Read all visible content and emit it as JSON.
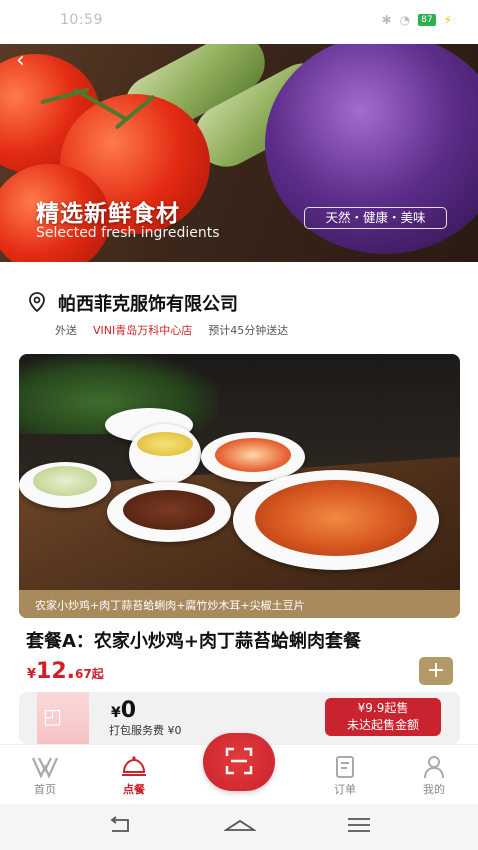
{
  "status_bar": {
    "time": "10:59",
    "battery": "87"
  },
  "hero": {
    "title": "精选新鲜食材",
    "subtitle": "Selected fresh ingredients",
    "tag": "天然・健康・美味"
  },
  "store": {
    "name": "帕西菲克服饰有限公司",
    "delivery_type": "外送",
    "branch": "VINI青岛万科中心店",
    "eta": "预计45分钟送达"
  },
  "product": {
    "caption": "农家小炒鸡+肉丁蒜苔蛤蜊肉+腐竹炒木耳+尖椒土豆片",
    "title": "套餐A：农家小炒鸡+肉丁蒜苔蛤蜊肉套餐",
    "price_currency": "¥",
    "price_main": "12.",
    "price_decimal": "67起",
    "add_label": "+"
  },
  "cart": {
    "currency": "¥",
    "total": "0",
    "pack_fee": "打包服务费 ¥0",
    "min_line1": "¥9.9起售",
    "min_line2": "未达起售金额"
  },
  "tabs": [
    {
      "label": "首页",
      "icon": "home-logo-icon"
    },
    {
      "label": "点餐",
      "icon": "cloche-icon"
    },
    {
      "label": "订单",
      "icon": "order-icon"
    },
    {
      "label": "我的",
      "icon": "user-icon"
    }
  ],
  "colors": {
    "brand": "#c8232f",
    "gold": "#b49a69",
    "caption_bar": "#a88a5c"
  }
}
